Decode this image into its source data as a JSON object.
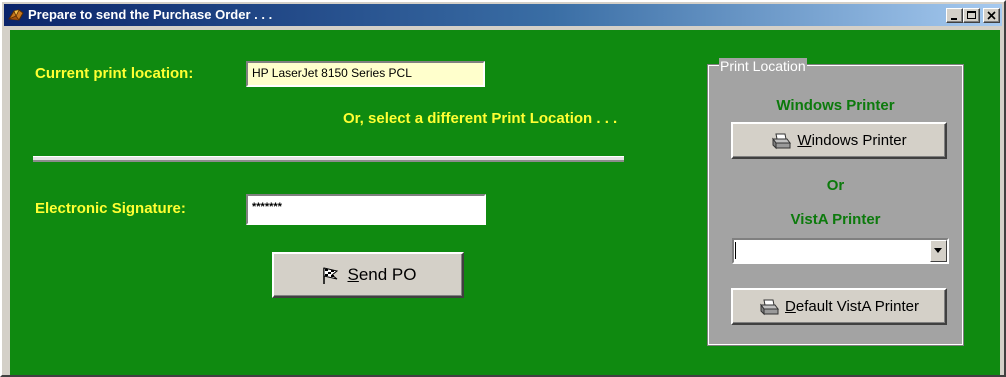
{
  "window": {
    "title": "Prepare to send the Purchase Order . . .",
    "title_color": "#ffffff",
    "titlebar_color": "#0a246a"
  },
  "main": {
    "background_color": "#0f8a10",
    "label_color": "#ffff33",
    "current_location_label": "Current print location:",
    "current_location_value": "HP LaserJet 8150 Series PCL",
    "select_different_text": "Or, select a different Print Location . . .",
    "signature_label": "Electronic Signature:",
    "signature_value": "*******",
    "send_button_label": "Send PO",
    "send_button_mnemonic": "S",
    "send_button_rest": "end PO",
    "send_button_icon": "checkered-flag-icon"
  },
  "print_location": {
    "group_title": "Print Location",
    "windows_printer_heading": "Windows Printer",
    "windows_printer_button_mnemonic": "W",
    "windows_printer_button_rest": "indows Printer",
    "or_text": "Or",
    "vista_printer_heading": "VistA Printer",
    "vista_printer_selected": "",
    "default_vista_button_mnemonic": "D",
    "default_vista_button_rest": "efault VistA Printer",
    "printer_icon": "printer-icon",
    "heading_color": "#0c7a0c"
  }
}
